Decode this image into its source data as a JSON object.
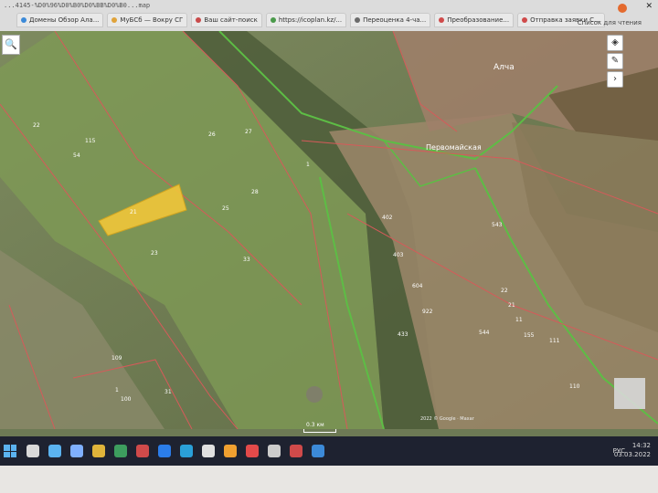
{
  "browser": {
    "url": "...4145-%D0%96%D0%B0%D0%BB%D0%B0...map",
    "tabs": [
      {
        "label": "Домены Обзор Ала...",
        "color": "#3c8ad8"
      },
      {
        "label": "МуБСб — Вокру СГ",
        "color": "#e0a33a"
      },
      {
        "label": "Ваш сайт-поиск",
        "color": "#c94a4a"
      },
      {
        "label": "https://icoplan.kz/...",
        "color": "#4a9a4a"
      },
      {
        "label": "Переоценка 4-ча...",
        "color": "#6b6b6b"
      },
      {
        "label": "Преобразование...",
        "color": "#d04a4a"
      },
      {
        "label": "Отправка заявки С...",
        "color": "#d04a4a"
      }
    ],
    "bookmark_list": "Список для чтения",
    "close": "✕"
  },
  "map": {
    "search_icon": "🔍",
    "tools": [
      "◈",
      "✎",
      "›"
    ],
    "places": [
      {
        "label": "Алча"
      },
      {
        "label": "Первомайская"
      }
    ],
    "parcels": [
      "22",
      "115",
      "54",
      "26",
      "27",
      "25",
      "21",
      "23",
      "33",
      "28",
      "1",
      "402",
      "403",
      "604",
      "922",
      "433",
      "543",
      "544",
      "22",
      "21",
      "11",
      "155",
      "109",
      "1",
      "100",
      "111",
      "110",
      "31"
    ],
    "scale_label": "0.3 км",
    "attribution": "2022 © Google · Maxar"
  },
  "taskbar": {
    "apps": [
      {
        "name": "search",
        "color": "#d9d9d9"
      },
      {
        "name": "task-view",
        "color": "#5bb3f0"
      },
      {
        "name": "code",
        "color": "#7fb0ff"
      },
      {
        "name": "chrome",
        "color": "#e0b43a"
      },
      {
        "name": "app",
        "color": "#3d9d5e"
      },
      {
        "name": "app2",
        "color": "#d04a4a"
      },
      {
        "name": "app3",
        "color": "#2b7de9"
      },
      {
        "name": "app4",
        "color": "#2aa0d8"
      },
      {
        "name": "app5",
        "color": "#e0e0e0"
      },
      {
        "name": "app6",
        "color": "#f0a030"
      },
      {
        "name": "app7",
        "color": "#e34a4a"
      },
      {
        "name": "app8",
        "color": "#cccccc"
      },
      {
        "name": "app9",
        "color": "#d04a4a"
      },
      {
        "name": "app10",
        "color": "#3c8ad8"
      }
    ],
    "lang": "РУС",
    "time": "14:32",
    "date": "03.03.2022"
  }
}
